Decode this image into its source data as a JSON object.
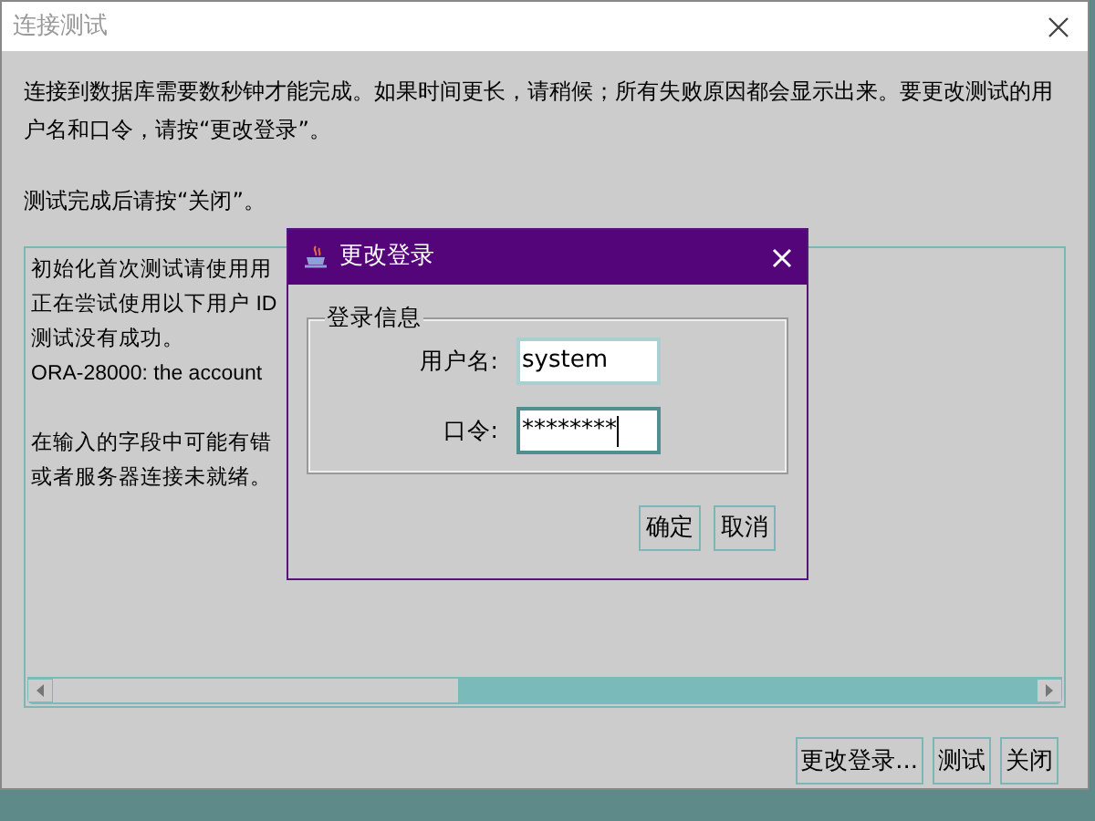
{
  "window": {
    "title": "连接测试"
  },
  "intro": [
    "连接到数据库需要数秒钟才能完成。如果时间更长，请稍候；所有失败原因都会显示出来。要更改测试的用户名和口令，请按“更改登录”。",
    "测试完成后请按“关闭”。"
  ],
  "log": [
    [
      "初始化首次测试请使用用",
      "正在尝试使用以下用户 ID",
      "测试没有成功。",
      "ORA-28000: the account"
    ],
    [
      "在输入的字段中可能有错",
      "或者服务器连接未就绪。"
    ]
  ],
  "buttons": [
    "更改登录...",
    "测试",
    "关闭"
  ],
  "dialog": {
    "title": "更改登录",
    "group": "登录信息",
    "fields": [
      {
        "label": "用户名:",
        "value": "system",
        "focused": false
      },
      {
        "label": "口令:",
        "value": "********",
        "focused": true
      }
    ],
    "buttons": [
      "确定",
      "取消"
    ]
  }
}
